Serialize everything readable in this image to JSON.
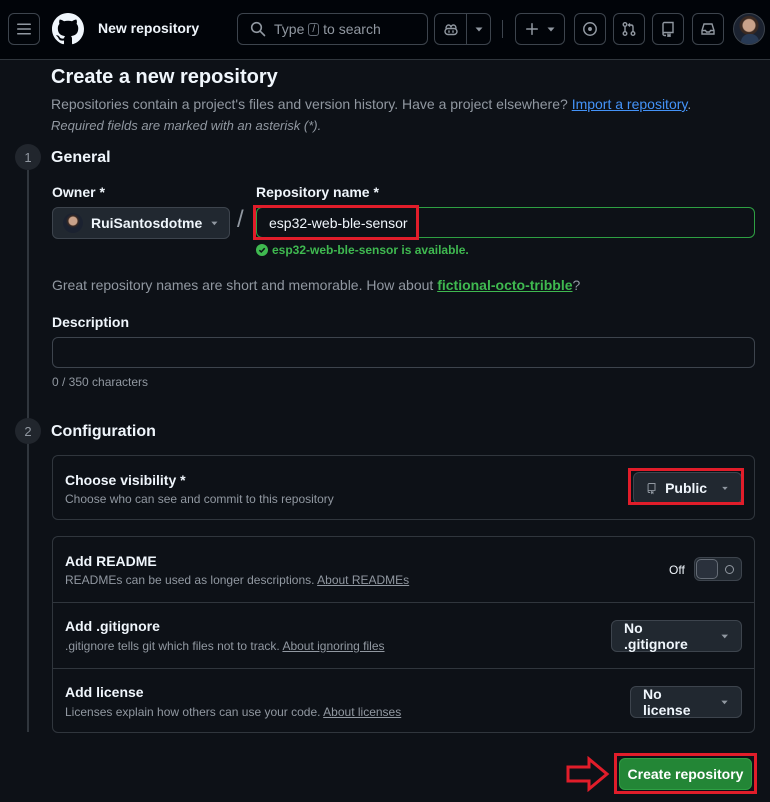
{
  "header": {
    "page_crumb": "New repository",
    "search": {
      "before": "Type",
      "key": "/",
      "after": "to search"
    }
  },
  "page": {
    "title": "Create a new repository",
    "subtitle": "Repositories contain a project's files and version history. Have a project elsewhere?",
    "import_link": "Import a repository",
    "subtitle_end": ".",
    "required_note": "Required fields are marked with an asterisk (*)."
  },
  "steps": [
    {
      "number": "1",
      "title": "General"
    },
    {
      "number": "2",
      "title": "Configuration"
    }
  ],
  "general": {
    "owner_label": "Owner *",
    "owner_value": "RuiSantosdotme",
    "separator": "/",
    "repo_label": "Repository name *",
    "repo_value": "esp32-web-ble-sensor",
    "availability": "esp32-web-ble-sensor is available.",
    "suggestion_prefix": "Great repository names are short and memorable. How about",
    "suggestion_name": "fictional-octo-tribble",
    "suggestion_suffix": "?",
    "description_label": "Description",
    "description_value": "",
    "char_count": "0 / 350 characters"
  },
  "configuration": {
    "visibility": {
      "title": "Choose visibility *",
      "desc": "Choose who can see and commit to this repository",
      "value": "Public"
    },
    "readme": {
      "title": "Add README",
      "desc": "READMEs can be used as longer descriptions.",
      "link": "About READMEs",
      "toggle_label": "Off",
      "enabled": false
    },
    "gitignore": {
      "title": "Add .gitignore",
      "desc": ".gitignore tells git which files not to track.",
      "link": "About ignoring files",
      "value": "No .gitignore"
    },
    "license": {
      "title": "Add license",
      "desc": "Licenses explain how others can use your code.",
      "link": "About licenses",
      "value": "No license"
    }
  },
  "actions": {
    "create_label": "Create repository"
  },
  "colors": {
    "background": "#0d1117",
    "accent_green": "#238636",
    "success_text": "#3fb950",
    "link": "#4493f8",
    "annotation_red": "#e11d2a"
  },
  "icons": [
    "menu-icon",
    "github-logo-icon",
    "search-icon",
    "copilot-icon",
    "plus-icon",
    "issues-icon",
    "pull-requests-icon",
    "repo-icon",
    "inbox-icon",
    "check-circle-icon",
    "chevron-down-icon",
    "arrow-right-icon"
  ]
}
